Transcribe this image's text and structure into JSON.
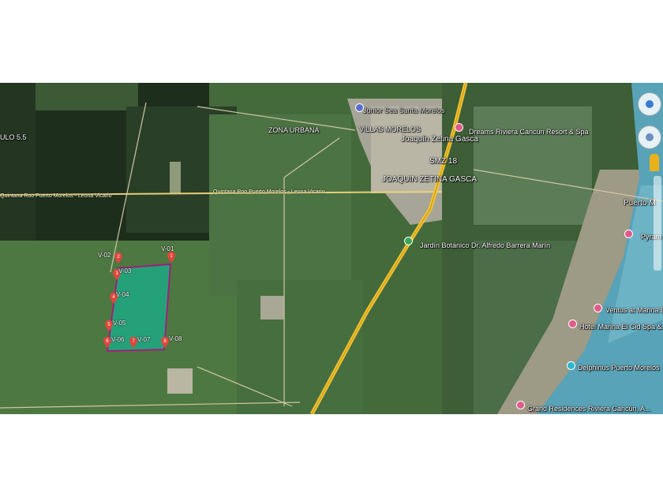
{
  "map": {
    "road_labels": {
      "highway_west": "Quintana Roo Puerto Morelos - Leona Vicario",
      "highway_center": "Quintana Roo Puerto Morelos - Leona Vicario"
    },
    "place_labels": {
      "ulo": "ULO 5.5",
      "zona_urbana": "ZONA URBANA",
      "villas": "VILLAS MORELOS",
      "joaquin1": "Joaquín Zetina Gasca",
      "smz": "SMZ 18",
      "joaquin2": "JOAQUIN ZETINA GASCA",
      "junior": "Junior Sea Santa Morelos",
      "dreams": "Dreams Riviera Cancun Resort & Spa",
      "jardin": "Jardín Botánico Dr. Alfredo Barrera Marín",
      "puerto": "Puerto M",
      "pyramid": "Pyram",
      "ventus": "Ventus at Marina El C",
      "hotel_marina": "Hotel Marina El Cid Spa & Be",
      "delphinus": "Delphinus Puerto Morelos",
      "grand": "Grand Residences Riviera Cancún, A..."
    },
    "vertices": [
      "V-01",
      "V-02",
      "V-03",
      "V-04",
      "V-05",
      "V-06",
      "V-07",
      "V-08"
    ],
    "vertex_numbers": [
      "1",
      "2",
      "3",
      "4",
      "5",
      "6",
      "7",
      "8"
    ],
    "colors": {
      "parcel_fill": "#1fa882",
      "parcel_stroke": "#a0207c",
      "pin": "#e0463c",
      "highway": "#f1c232",
      "sea": "#58a3b8"
    },
    "controls": {
      "compass": "compass-control",
      "pegman": "street-view-pegman"
    }
  }
}
